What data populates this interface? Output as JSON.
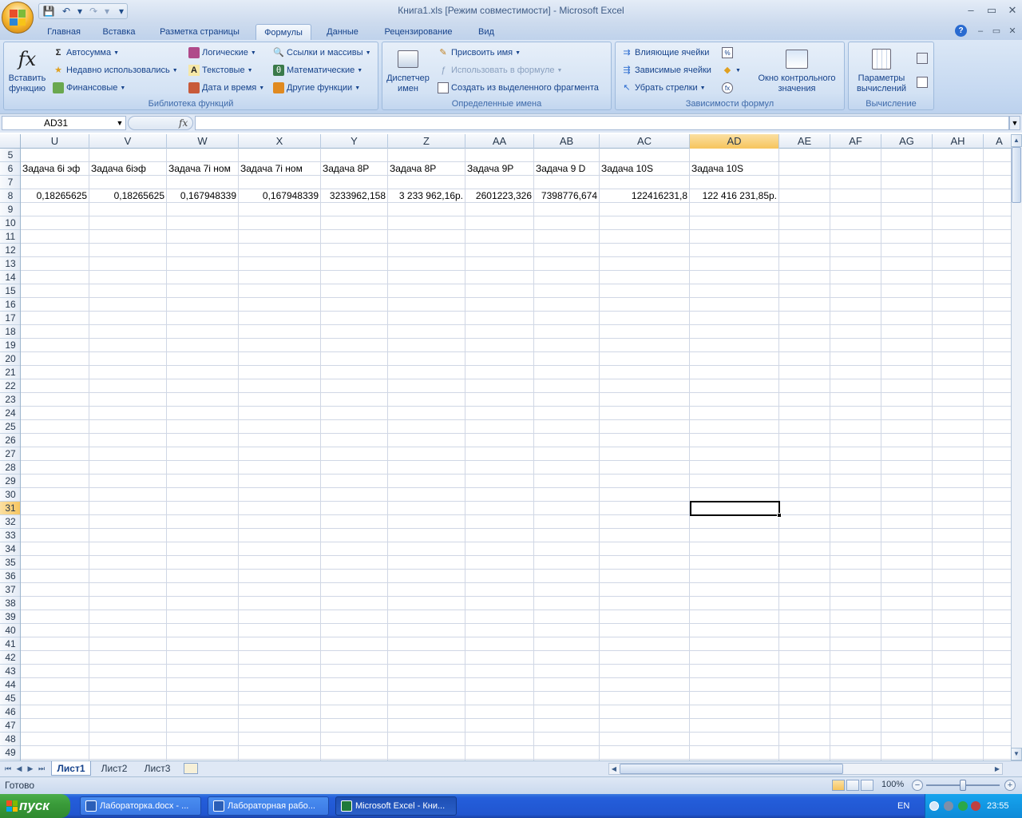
{
  "window": {
    "title": "Книга1.xls  [Режим совместимости] - Microsoft Excel",
    "min": "–",
    "max": "▭",
    "close": "✕"
  },
  "qat": {
    "save": "💾",
    "undo": "↶",
    "redo": "↷",
    "customize": "▾"
  },
  "tabs": [
    "Главная",
    "Вставка",
    "Разметка страницы",
    "Формулы",
    "Данные",
    "Рецензирование",
    "Вид"
  ],
  "help_icon": "?",
  "ribbon": {
    "function_library": {
      "title": "Библиотека функций",
      "insert_function": "Вставить функцию",
      "autosum": "Автосумма",
      "recent": "Недавно использовались",
      "financial": "Финансовые",
      "logical": "Логические",
      "text": "Текстовые",
      "datetime": "Дата и время",
      "lookup": "Ссылки и массивы",
      "math": "Математические",
      "other": "Другие функции"
    },
    "defined_names": {
      "title": "Определенные имена",
      "name_manager": "Диспетчер имен",
      "define_name": "Присвоить имя",
      "use_in_formula": "Использовать в формуле",
      "create_from_selection": "Создать из выделенного фрагмента"
    },
    "formula_auditing": {
      "title": "Зависимости формул",
      "trace_precedents": "Влияющие ячейки",
      "trace_dependents": "Зависимые ячейки",
      "remove_arrows": "Убрать стрелки",
      "watch_window": "Окно контрольного значения"
    },
    "calculation": {
      "title": "Вычисление",
      "options": "Параметры вычислений"
    }
  },
  "formula_bar": {
    "name_box": "AD31",
    "fx": "fx",
    "formula": ""
  },
  "columns": [
    "U",
    "V",
    "W",
    "X",
    "Y",
    "Z",
    "AA",
    "AB",
    "AC",
    "AD",
    "AE",
    "AF",
    "AG",
    "AH",
    "A"
  ],
  "selected_column": "AD",
  "rows": [
    5,
    6,
    7,
    8,
    9,
    10,
    11,
    12,
    13,
    14,
    15,
    16,
    17,
    18,
    19,
    20,
    21,
    22,
    23,
    24,
    25,
    26,
    27,
    28,
    29,
    30,
    31,
    32,
    33,
    34,
    35,
    36,
    37,
    38,
    39,
    40,
    41,
    42,
    43,
    44,
    45,
    46,
    47,
    48,
    49
  ],
  "selected_row": 31,
  "row6": [
    "Задача 6i эф",
    "Задача 6iэф",
    "Задача 7i ном",
    "Задача 7i ном",
    "Задача 8P",
    "Задача 8P",
    "Задача 9P",
    "Задача 9 D",
    "Задача 10S",
    "Задача 10S"
  ],
  "row8": [
    "0,18265625",
    "0,18265625",
    "0,167948339",
    "0,167948339",
    "3233962,158",
    "3 233 962,16р.",
    "2601223,326",
    "7398776,674",
    "122416231,8",
    "122 416 231,85р."
  ],
  "sheets": [
    "Лист1",
    "Лист2",
    "Лист3"
  ],
  "status": {
    "ready": "Готово",
    "zoom": "100%",
    "zoom_out": "−",
    "zoom_in": "+"
  },
  "taskbar": {
    "start": "пуск",
    "tasks": [
      "Лабораторка.docx - ...",
      "Лабораторная рабо...",
      "Microsoft Excel - Кни..."
    ],
    "lang": "EN",
    "clock": "23:55"
  }
}
